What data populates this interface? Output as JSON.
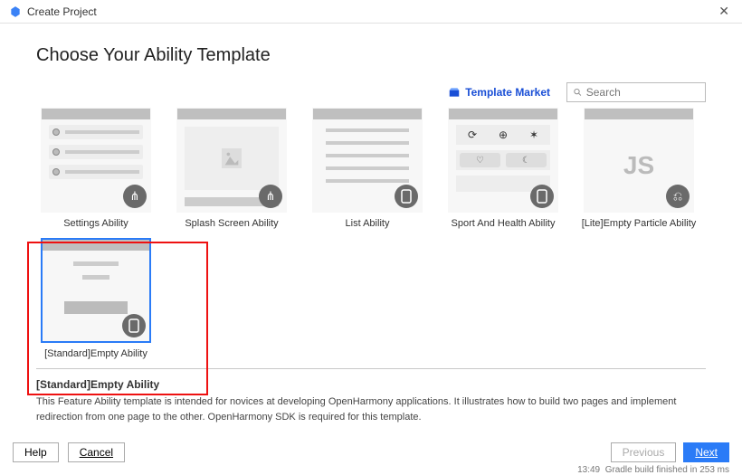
{
  "titlebar": {
    "title": "Create Project"
  },
  "heading": "Choose Your Ability Template",
  "toolbar": {
    "market_label": "Template Market",
    "search_placeholder": "Search"
  },
  "templates_row1": [
    {
      "label": "Settings Ability",
      "badge": "share"
    },
    {
      "label": "Splash Screen Ability",
      "badge": "share"
    },
    {
      "label": "List Ability",
      "badge": "phone"
    },
    {
      "label": "Sport And Health Ability",
      "badge": "phone"
    },
    {
      "label": "[Lite]Empty Particle Ability",
      "badge": "router"
    }
  ],
  "templates_row2": [
    {
      "label": "[Standard]Empty Ability",
      "badge": "phone",
      "selected": true
    }
  ],
  "description": {
    "title": "[Standard]Empty Ability",
    "text": "This Feature Ability template is intended for novices at developing OpenHarmony applications. It illustrates how to build two pages and implement redirection from one page to the other. OpenHarmony SDK is required for this template."
  },
  "footer": {
    "help": "Help",
    "cancel": "Cancel",
    "previous": "Previous",
    "next": "Next"
  },
  "statusbar": {
    "right": "Gradle build finished in 253 ms",
    "time": "13:49"
  }
}
